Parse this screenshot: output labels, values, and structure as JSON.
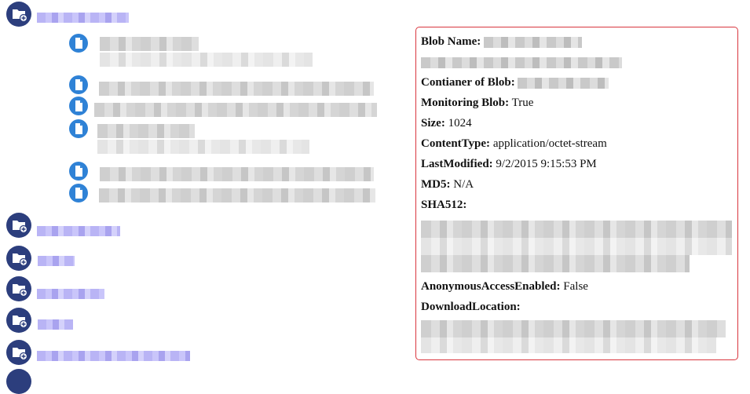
{
  "tree": {
    "folders": [
      {
        "icon": "folder-add-icon"
      },
      {
        "icon": "folder-add-icon"
      },
      {
        "icon": "folder-add-icon"
      },
      {
        "icon": "folder-add-icon"
      },
      {
        "icon": "folder-add-icon"
      },
      {
        "icon": "folder-add-icon"
      }
    ],
    "files": [
      {
        "icon": "file-icon"
      },
      {
        "icon": "file-icon"
      },
      {
        "icon": "file-icon"
      },
      {
        "icon": "file-icon"
      },
      {
        "icon": "file-icon"
      },
      {
        "icon": "file-icon"
      }
    ]
  },
  "details": {
    "blob_name_label": "Blob Name:",
    "container_label": "Contianer of Blob:",
    "monitoring_label": "Monitoring Blob:",
    "monitoring_value": "True",
    "size_label": "Size:",
    "size_value": "1024",
    "content_type_label": "ContentType:",
    "content_type_value": "application/octet-stream",
    "last_modified_label": "LastModified:",
    "last_modified_value": "9/2/2015 9:15:53 PM",
    "md5_label": "MD5:",
    "md5_value": "N/A",
    "sha512_label": "SHA512:",
    "anonymous_label": "AnonymousAccessEnabled:",
    "anonymous_value": "False",
    "download_label": "DownloadLocation:"
  },
  "colors": {
    "folder_icon": "#2c3e7d",
    "file_icon": "#2f82d6",
    "panel_border": "#d9363e",
    "link_text": "#b9b4f5"
  }
}
